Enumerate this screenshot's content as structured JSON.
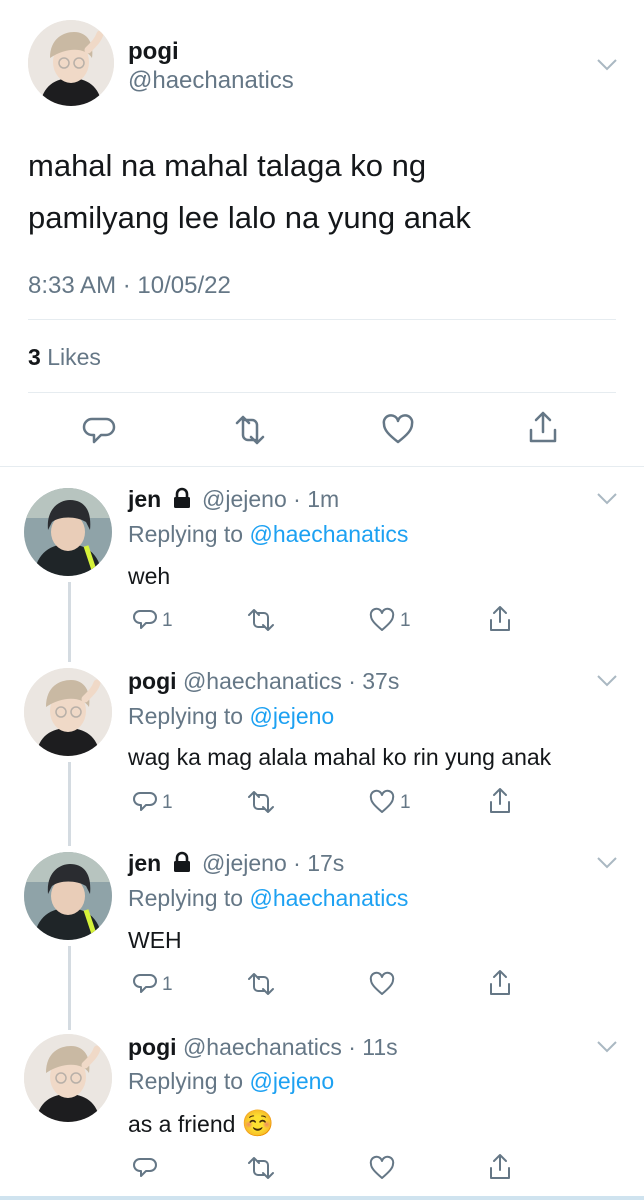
{
  "main_tweet": {
    "display_name": "pogi",
    "handle": "@haechanatics",
    "text_line1": "mahal na mahal talaga ko ng",
    "text_line2": "pamilyang lee lalo na yung anak",
    "timestamp": "8:33 AM · 10/05/22",
    "likes_count": "3",
    "likes_label": "Likes"
  },
  "replies": [
    {
      "display_name": "jen",
      "locked": true,
      "handle": "@jejeno",
      "time": "· 1m",
      "replying_prefix": "Replying to",
      "replying_to": "@haechanatics",
      "text": "weh",
      "reply_count": "1",
      "like_count": "1"
    },
    {
      "display_name": "pogi",
      "locked": false,
      "handle": "@haechanatics",
      "time": "· 37s",
      "replying_prefix": "Replying to",
      "replying_to": "@jejeno",
      "text": "wag ka mag alala mahal ko rin yung anak",
      "reply_count": "1",
      "like_count": "1"
    },
    {
      "display_name": "jen",
      "locked": true,
      "handle": "@jejeno",
      "time": "· 17s",
      "replying_prefix": "Replying to",
      "replying_to": "@haechanatics",
      "text": "WEH",
      "reply_count": "1",
      "like_count": ""
    },
    {
      "display_name": "pogi",
      "locked": false,
      "handle": "@haechanatics",
      "time": "· 11s",
      "replying_prefix": "Replying to",
      "replying_to": "@jejeno",
      "text": "as a friend",
      "emoji": "☺️",
      "reply_count": "",
      "like_count": ""
    }
  ],
  "colors": {
    "link": "#1da1f2",
    "muted": "#657786",
    "divider": "#e6ecf0",
    "thread_line": "#d4dbe1"
  },
  "icons": [
    "reply-icon",
    "retweet-icon",
    "like-icon",
    "share-icon",
    "lock-icon",
    "chevron-down-icon"
  ]
}
